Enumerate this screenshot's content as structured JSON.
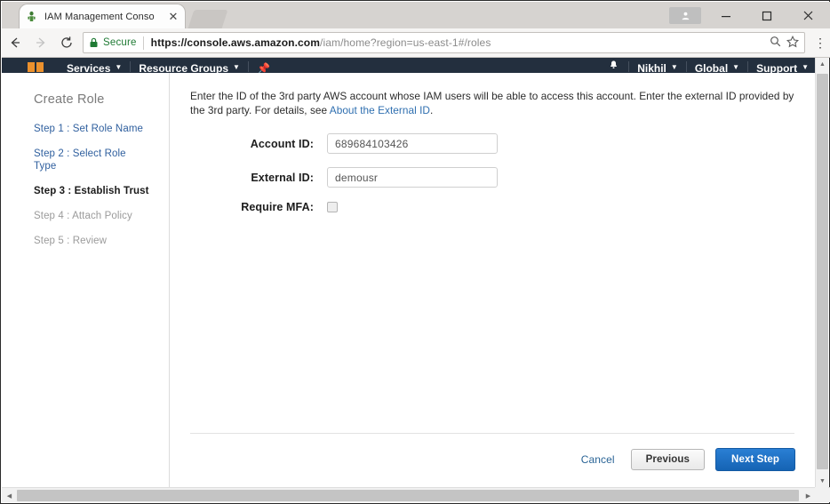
{
  "browser": {
    "tab": {
      "title": "IAM Management Conso",
      "favicon_icon": "aws-iam-favicon",
      "close_icon": "close-icon",
      "new_tab_icon": "new-tab-icon"
    },
    "caption": {
      "profile_icon": "profile-icon",
      "minimize_label": "—",
      "maximize_label": "☐",
      "close_label": "✕"
    },
    "toolbar": {
      "back_icon": "back-arrow-icon",
      "forward_icon": "forward-arrow-icon",
      "reload_icon": "reload-icon",
      "lock_icon": "lock-icon",
      "secure_label": "Secure",
      "url_scheme": "https://console.aws.amazon.com",
      "url_path": "/iam/home?region=us-east-1#/roles",
      "zoom_icon": "search-zoom-icon",
      "bookmark_icon": "star-icon",
      "menu_icon": "kebab-menu-icon"
    }
  },
  "aws_nav": {
    "logo_icon": "aws-logo-icon",
    "services_label": "Services",
    "resource_groups_label": "Resource Groups",
    "pin_icon": "pin-icon",
    "bell_icon": "bell-icon",
    "account_label": "Nikhil",
    "region_label": "Global",
    "support_label": "Support",
    "caret_icon": "chevron-down-icon"
  },
  "sidebar": {
    "title": "Create Role",
    "steps": [
      {
        "label": "Step 1 : Set Role Name",
        "state": "link"
      },
      {
        "label": "Step 2 : Select Role Type",
        "state": "link"
      },
      {
        "label": "Step 3 : Establish Trust",
        "state": "current"
      },
      {
        "label": "Step 4 : Attach Policy",
        "state": "future"
      },
      {
        "label": "Step 5 : Review",
        "state": "future"
      }
    ]
  },
  "content": {
    "intro_part1": "Enter the ID of the 3rd party AWS account whose IAM users will be able to access this account. Enter the external ID provided by the 3rd party. For details, see ",
    "intro_link": "About the External ID",
    "intro_part2": ".",
    "fields": [
      {
        "label": "Account ID:",
        "value": "689684103426",
        "placeholder": "Account ID",
        "type": "text"
      },
      {
        "label": "External ID:",
        "value": "demousr",
        "placeholder": "External ID",
        "type": "text"
      },
      {
        "label": "Require MFA:",
        "value": "",
        "placeholder": "",
        "type": "checkbox",
        "checked": false
      }
    ]
  },
  "footer": {
    "cancel_label": "Cancel",
    "previous_label": "Previous",
    "next_label": "Next Step"
  },
  "scrollbars": {
    "up_arrow": "▲",
    "down_arrow": "▼",
    "left_arrow": "◀",
    "right_arrow": "▶"
  },
  "colors": {
    "aws_nav_bg": "#232f3e",
    "aws_orange": "#ec912d",
    "primary_button": "#1563b4",
    "link_blue": "#2f6fb0",
    "secure_green": "#1f7a34"
  }
}
